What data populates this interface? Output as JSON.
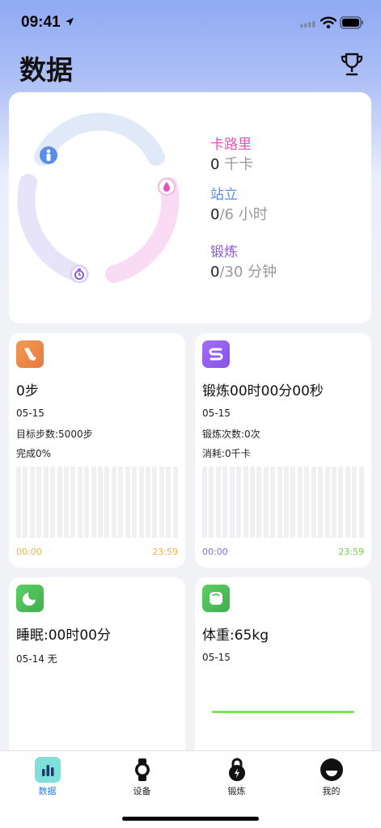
{
  "status": {
    "time": "09:41"
  },
  "page": {
    "title": "数据"
  },
  "rings": {
    "calories": {
      "label": "卡路里",
      "value": "0",
      "unit": " 千卡"
    },
    "stand": {
      "label": "站立",
      "value": "0",
      "goal": "/6 小时"
    },
    "exercise": {
      "label": "锻炼",
      "value": "0",
      "goal": "/30 分钟"
    }
  },
  "steps_card": {
    "title": "0步",
    "date": "05-15",
    "goal": "目标步数:5000步",
    "complete": "完成0%",
    "start_time": "00:00",
    "end_time": "23:59"
  },
  "workout_card": {
    "title": "锻炼00时00分00秒",
    "date": "05-15",
    "count": "锻炼次数:0次",
    "consumed": "消耗:0千卡",
    "start_time": "00:00",
    "end_time": "23:59"
  },
  "sleep_card": {
    "title": "睡眠:00时00分",
    "date": "05-14 无"
  },
  "weight_card": {
    "title": "体重:65kg",
    "date": "05-15"
  },
  "tabs": [
    {
      "label": "数据",
      "icon": "chart-icon",
      "active": true
    },
    {
      "label": "设备",
      "icon": "watch-icon",
      "active": false
    },
    {
      "label": "锻炼",
      "icon": "kettlebell-icon",
      "active": false
    },
    {
      "label": "我的",
      "icon": "smiley-icon",
      "active": false
    }
  ],
  "colors": {
    "calories": "#e356b9",
    "stand": "#5a8de8",
    "exercise": "#8b5bd9",
    "steps_icon": "#ee8a4c",
    "workout_icon": "#9b62f0",
    "sleep_icon": "#4fc25a",
    "weight_icon": "#4fc25a",
    "active_tab": "#2f7fe0"
  }
}
